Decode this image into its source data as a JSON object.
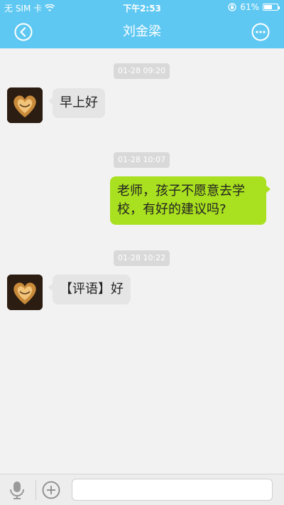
{
  "status_bar": {
    "carrier": "无 SIM 卡",
    "time": "下午2:53",
    "battery": "61%",
    "battery_level": 0.61
  },
  "nav": {
    "title": "刘金梁",
    "back_icon": "back-circle-icon",
    "more_icon": "more-circle-icon"
  },
  "messages": [
    {
      "timestamp": "01-28 09:20",
      "direction": "in",
      "text": "早上好"
    },
    {
      "timestamp": "01-28 10:07",
      "direction": "out",
      "text": "老师，孩子不愿意去学校，有好的建议吗?"
    },
    {
      "timestamp": "01-28 10:22",
      "direction": "in",
      "text": "【评语】好"
    }
  ],
  "composer": {
    "mic_icon": "microphone-icon",
    "add_icon": "plus-circle-icon",
    "input_value": ""
  },
  "colors": {
    "header_blue": "#5fc8f2",
    "outgoing_green": "#a9e01f",
    "incoming_gray": "#e5e5e5"
  }
}
